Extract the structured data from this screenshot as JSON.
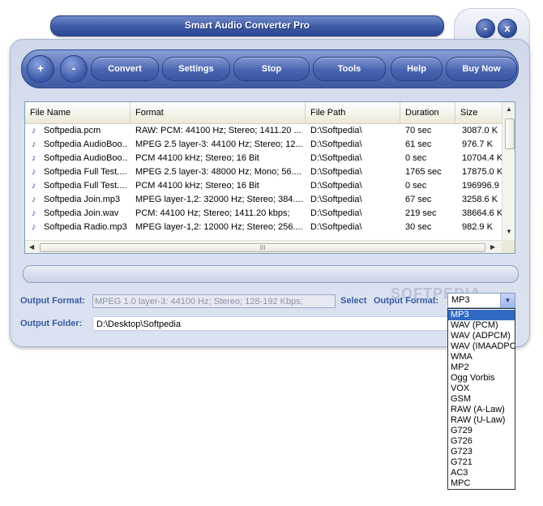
{
  "window": {
    "title": "Smart Audio Converter Pro"
  },
  "window_controls": {
    "minimize": "-",
    "close": "x"
  },
  "toolbar": {
    "add": "+",
    "remove": "-",
    "convert": "Convert",
    "settings": "Settings",
    "stop": "Stop",
    "tools": "Tools",
    "help": "Help",
    "buy_now": "Buy Now"
  },
  "file_list": {
    "columns": [
      "File Name",
      "Format",
      "File Path",
      "Duration",
      "Size"
    ],
    "rows": [
      [
        "Softpedia.pcm",
        "RAW: PCM: 44100 Hz;  Stereo; 1411.20 ...",
        "D:\\Softpedia\\",
        "70 sec",
        "3087.0 K"
      ],
      [
        "Softpedia AudioBoo...",
        "MPEG 2.5 layer-3: 44100 Hz;  Stereo; 12...",
        "D:\\Softpedia\\",
        "61 sec",
        "976.7 K"
      ],
      [
        "Softpedia AudioBoo...",
        "PCM 44100 kHz; Stereo; 16 Bit",
        "D:\\Softpedia\\",
        "0 sec",
        "10704.4 K"
      ],
      [
        "Softpedia Full Test....",
        "MPEG 2.5 layer-3: 48000 Hz;  Mono; 56....",
        "D:\\Softpedia\\",
        "1765 sec",
        "17875.0 K"
      ],
      [
        "Softpedia Full Test....",
        "PCM 44100 kHz; Stereo; 16 Bit",
        "D:\\Softpedia\\",
        "0 sec",
        "196996.9"
      ],
      [
        "Softpedia Join.mp3",
        "MPEG layer-1,2: 32000 Hz;  Stereo; 384....",
        "D:\\Softpedia\\",
        "67 sec",
        "3258.6 K"
      ],
      [
        "Softpedia Join.wav",
        "PCM: 44100 Hz;  Stereo; 1411.20 kbps;",
        "D:\\Softpedia\\",
        "219 sec",
        "38664.6 K"
      ],
      [
        "Softpedia Radio.mp3",
        "MPEG layer-1,2: 12000 Hz;  Stereo; 256....",
        "D:\\Softpedia\\",
        "30 sec",
        "982.9 K"
      ]
    ],
    "scroll_grip": "III"
  },
  "output": {
    "format_label": "Output Format:",
    "format_value": "MPEG 1.0 layer-3: 44100 Hz; Stereo;  128-192 Kbps;",
    "select_label": "Select",
    "select_format_label": "Output Format:",
    "selected": "MP3",
    "folder_label": "Output Folder:",
    "folder_value": "D:\\Desktop\\Softpedia"
  },
  "format_options": [
    "MP3",
    "WAV (PCM)",
    "WAV (ADPCM)",
    "WAV (IMAADPCM)",
    "WMA",
    "MP2",
    "Ogg Vorbis",
    "VOX",
    "GSM",
    "RAW (A-Law)",
    "RAW (U-Law)",
    "G729",
    "G726",
    "G723",
    "G721",
    "AC3",
    "MPC"
  ],
  "watermark": "SOFTPEDIA",
  "colors": {
    "accent": "#3d5aa6",
    "label": "#3b5aa5",
    "selection": "#316ac5"
  }
}
